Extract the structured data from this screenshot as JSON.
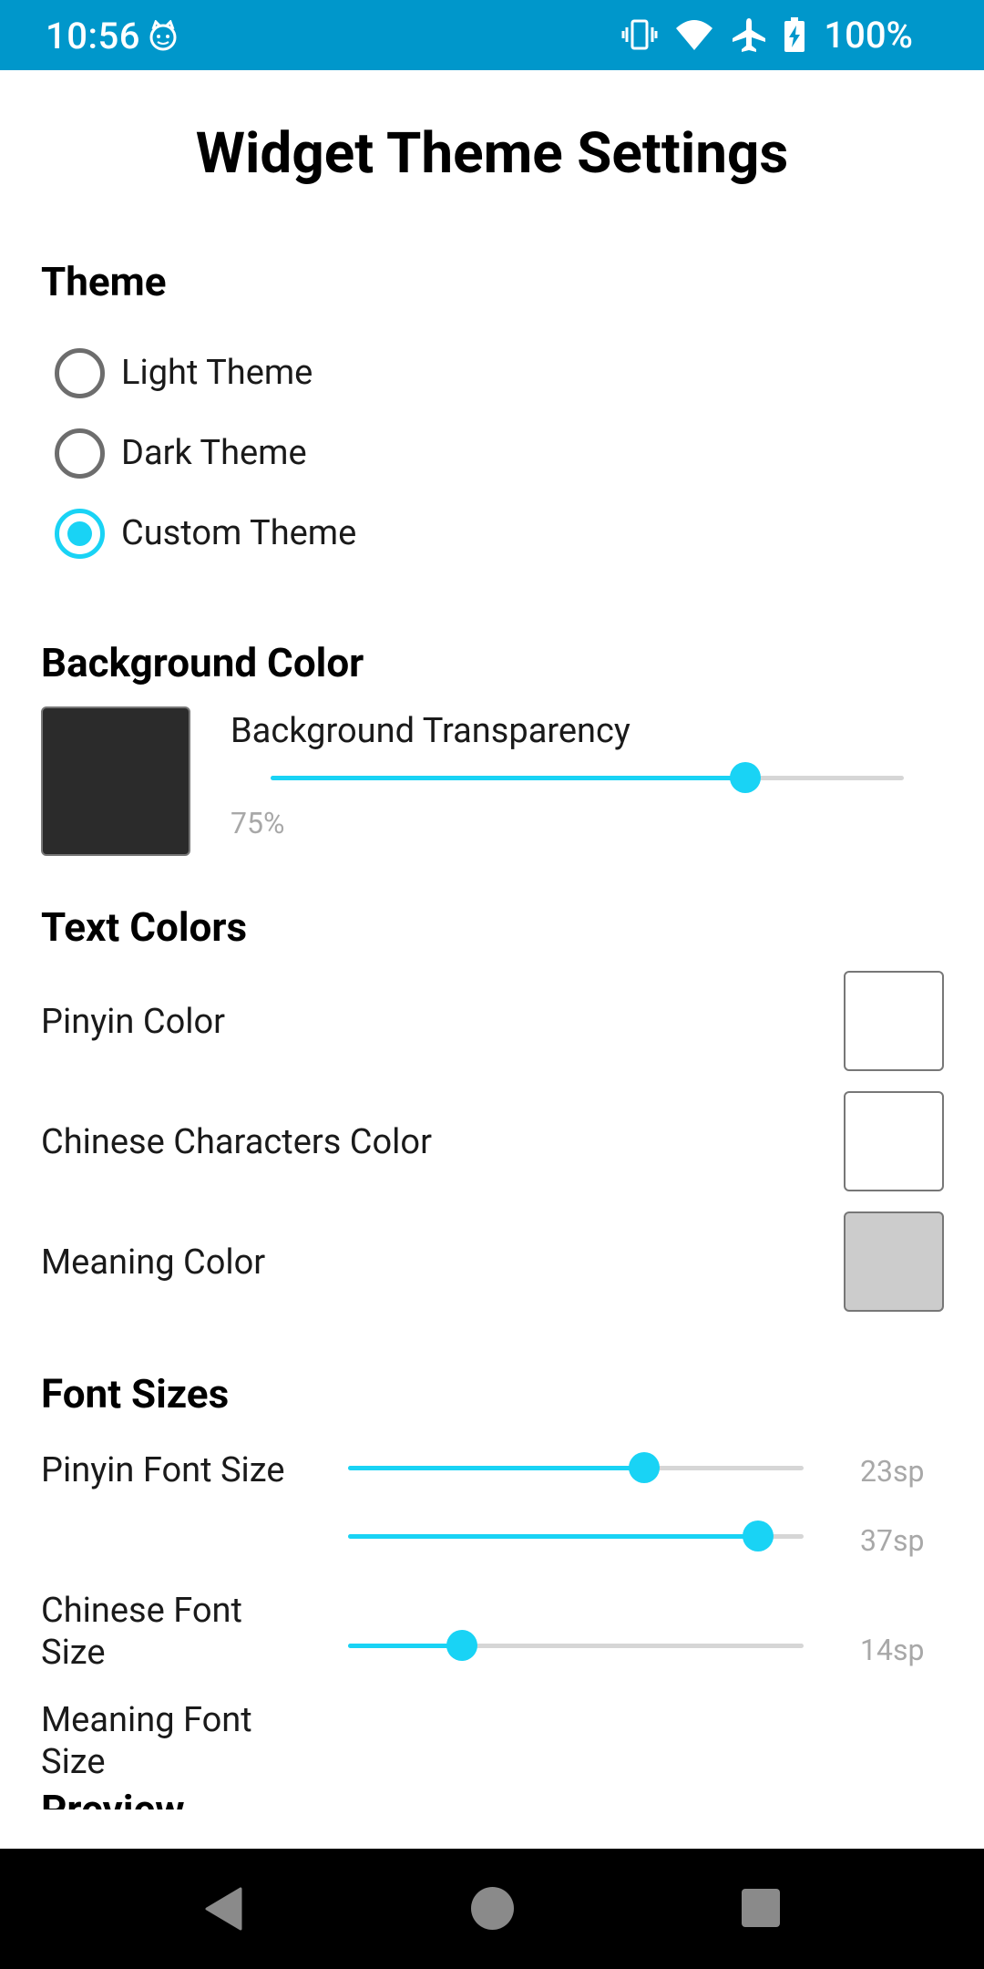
{
  "status_bar": {
    "time": "10:56",
    "battery_percent": "100%",
    "icons": [
      "cat-notification-icon",
      "vibrate-icon",
      "wifi-icon",
      "airplane-icon",
      "battery-charging-icon"
    ]
  },
  "header": {
    "title": "Widget Theme Settings"
  },
  "theme": {
    "heading": "Theme",
    "options": [
      {
        "label": "Light Theme",
        "selected": false
      },
      {
        "label": "Dark Theme",
        "selected": false
      },
      {
        "label": "Custom Theme",
        "selected": true
      }
    ]
  },
  "background": {
    "heading": "Background Color",
    "swatch_color": "#2b2b2b",
    "transparency_label": "Background Transparency",
    "transparency_value": "75%",
    "transparency_fraction": 0.75
  },
  "text_colors": {
    "heading": "Text Colors",
    "items": [
      {
        "label": "Pinyin Color",
        "color": "#ffffff"
      },
      {
        "label": "Chinese Characters Color",
        "color": "#ffffff"
      },
      {
        "label": "Meaning Color",
        "color": "#cccccc"
      }
    ]
  },
  "font_sizes": {
    "heading": "Font Sizes",
    "items": [
      {
        "label": "Pinyin Font Size",
        "value": "23sp",
        "fraction": 0.65
      },
      {
        "label": "Chinese Font Size",
        "value": "37sp",
        "fraction": 0.9
      },
      {
        "label": "Meaning Font Size",
        "value": "14sp",
        "fraction": 0.25
      }
    ]
  },
  "preview": {
    "heading": "Preview"
  },
  "colors": {
    "accent": "#19d3f5",
    "status_bar": "#0097cb"
  }
}
